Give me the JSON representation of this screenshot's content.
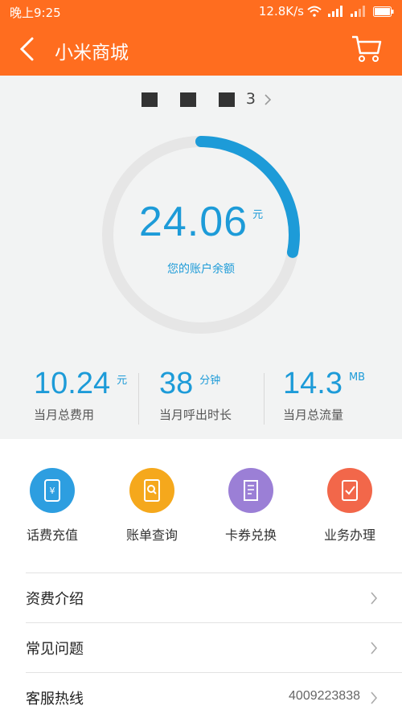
{
  "status_bar": {
    "time": "晚上9:25",
    "speed": "12.8K/s",
    "icons": [
      "wifi-icon",
      "signal-icon",
      "battery-icon"
    ]
  },
  "app_bar": {
    "title": "小米商城",
    "back_icon": "back-arrow-icon",
    "cart_icon": "cart-icon"
  },
  "account": {
    "display": "3"
  },
  "balance": {
    "value": "24.06",
    "unit": "元",
    "label": "您的账户余额",
    "gauge_fraction": 0.28
  },
  "stats": [
    {
      "value": "10.24",
      "unit": "元",
      "label": "当月总费用"
    },
    {
      "value": "38",
      "unit": "分钟",
      "label": "当月呼出时长"
    },
    {
      "value": "14.3",
      "unit": "MB",
      "label": "当月总流量"
    }
  ],
  "actions": [
    {
      "label": "话费充值",
      "icon": "recharge-icon",
      "color": "#2d9ee0"
    },
    {
      "label": "账单查询",
      "icon": "bill-search-icon",
      "color": "#f5a81c"
    },
    {
      "label": "卡券兑换",
      "icon": "coupon-icon",
      "color": "#9b7fd6"
    },
    {
      "label": "业务办理",
      "icon": "business-icon",
      "color": "#f2674a"
    }
  ],
  "menu": [
    {
      "label": "资费介绍",
      "value": ""
    },
    {
      "label": "常见问题",
      "value": ""
    },
    {
      "label": "客服热线",
      "value": "4009223838"
    }
  ],
  "colors": {
    "brand": "#ff6d1f",
    "accent": "#1d9bd8",
    "gauge_track": "#e6e6e6"
  }
}
